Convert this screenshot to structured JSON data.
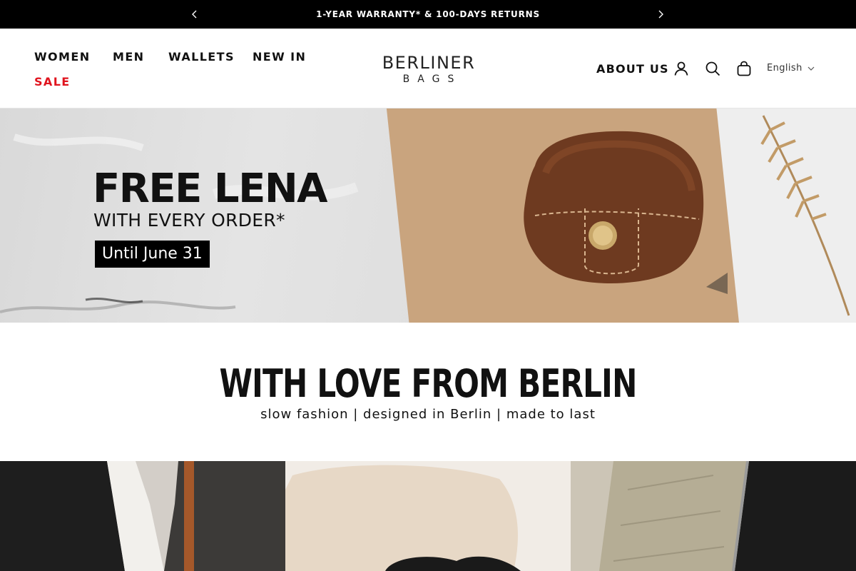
{
  "announcement": {
    "text": "1-YEAR WARRANTY* & 100-DAYS RETURNS",
    "prev_icon": "chevron-left-icon",
    "next_icon": "chevron-right-icon"
  },
  "header": {
    "nav": {
      "women": "WOMEN",
      "men": "MEN",
      "wallets": "WALLETS",
      "new_in": "NEW IN",
      "sale": "SALE"
    },
    "logo": {
      "top": "BERLINER",
      "bottom": "BAGS"
    },
    "about": "ABOUT US",
    "language": "English",
    "icons": [
      "account-icon",
      "search-icon",
      "cart-icon",
      "chevron-down-icon"
    ]
  },
  "hero": {
    "title": "FREE LENA",
    "subtitle": "WITH EVERY ORDER*",
    "badge": "Until June 31"
  },
  "section": {
    "title": "WITH LOVE FROM BERLIN",
    "subtitle": "slow fashion | designed in Berlin | made to last"
  },
  "colors": {
    "announcement_bg": "#000000",
    "sale_red": "#e0141e",
    "text": "#111111"
  }
}
